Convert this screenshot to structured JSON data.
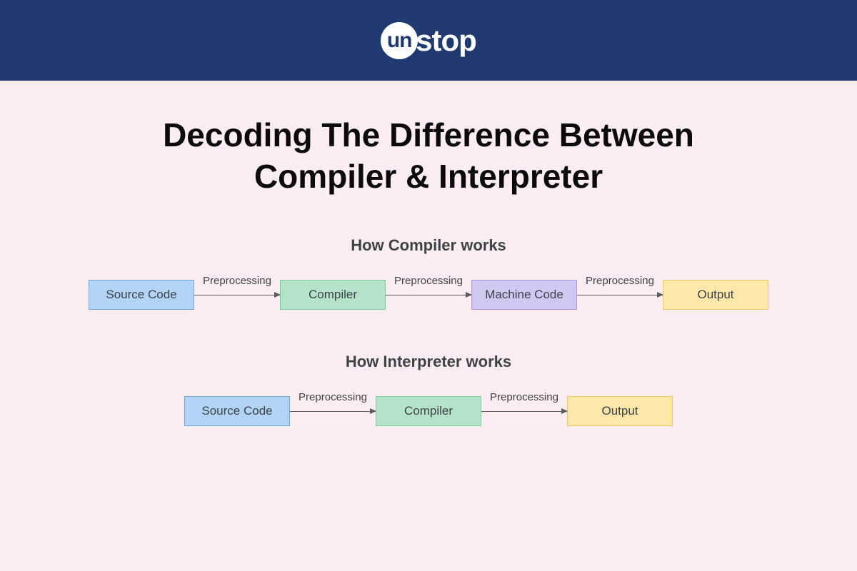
{
  "header": {
    "logo_circle": "un",
    "logo_text": "stop"
  },
  "title_line1": "Decoding The Difference Between",
  "title_line2": "Compiler & Interpreter",
  "compiler_section": {
    "title": "How Compiler works",
    "nodes": {
      "source_code": "Source Code",
      "compiler": "Compiler",
      "machine_code": "Machine Code",
      "output": "Output"
    },
    "arrow_labels": {
      "a1": "Preprocessing",
      "a2": "Preprocessing",
      "a3": "Preprocessing"
    }
  },
  "interpreter_section": {
    "title": "How Interpreter works",
    "nodes": {
      "source_code": "Source Code",
      "compiler": "Compiler",
      "output": "Output"
    },
    "arrow_labels": {
      "a1": "Preprocessing",
      "a2": "Preprocessing"
    }
  }
}
